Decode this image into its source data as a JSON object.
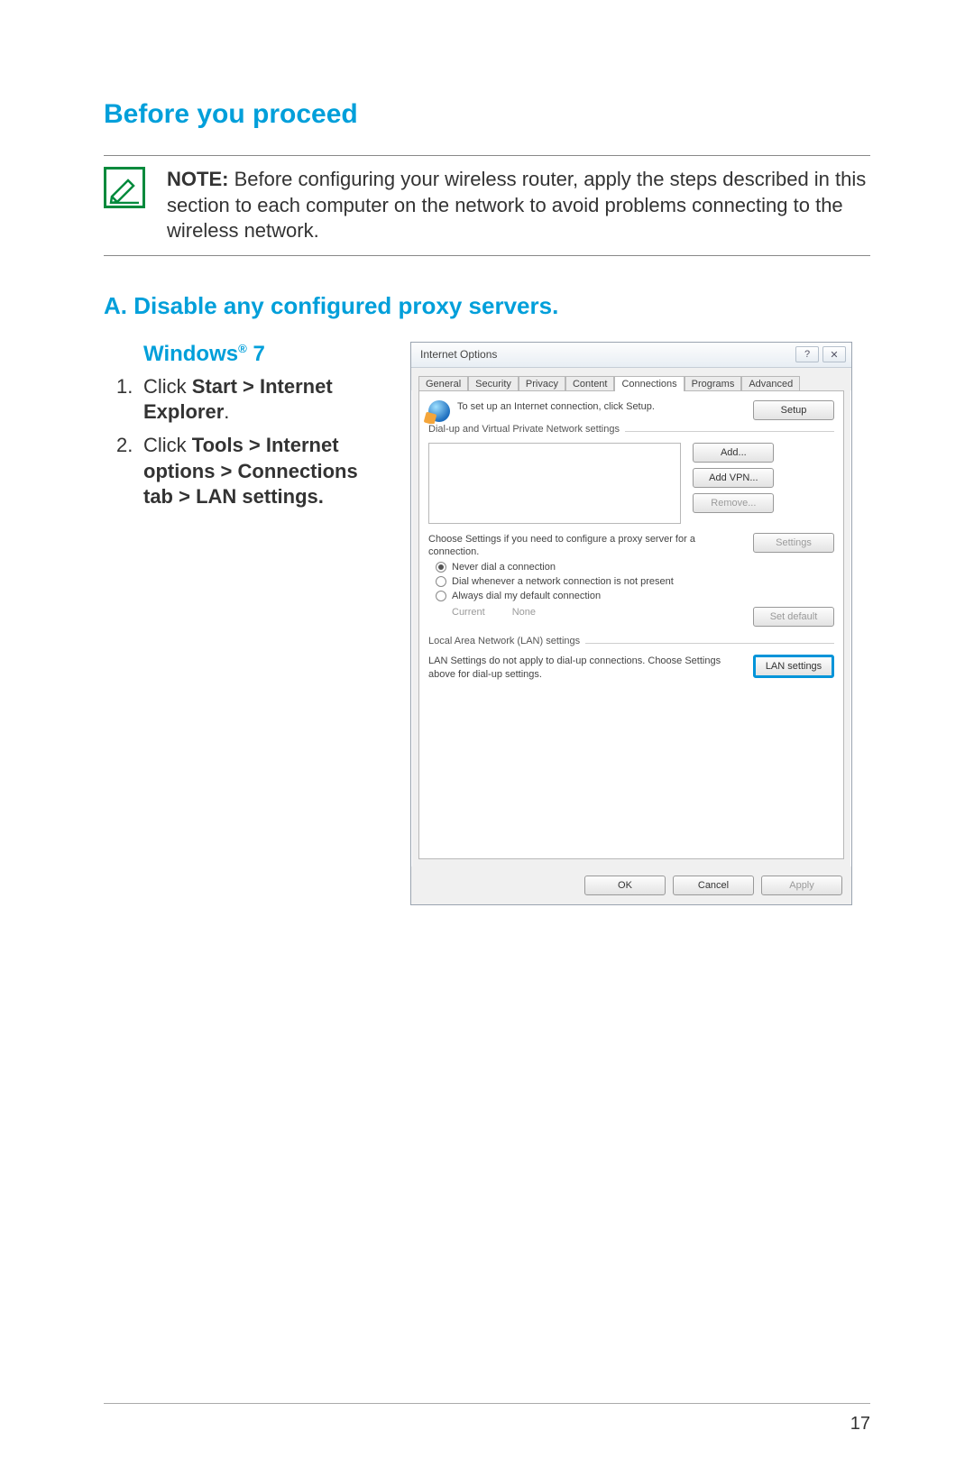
{
  "heading1": "Before you proceed",
  "note": {
    "label": "NOTE:",
    "text": " Before configuring your wireless router, apply the steps described in this section to each computer on the network to avoid problems connecting to the wireless network."
  },
  "heading2": "A.   Disable any configured proxy servers.",
  "heading3_prefix": "Windows",
  "heading3_suffix": " 7",
  "step1_lead": "Click ",
  "step1_bold": "Start > Internet Explorer",
  "step1_tail": ".",
  "step2_lead": "Click ",
  "step2_bold": "Tools > Internet options > Connections tab > LAN settings.",
  "dialog": {
    "title": "Internet Options",
    "tabs": [
      "General",
      "Security",
      "Privacy",
      "Content",
      "Connections",
      "Programs",
      "Advanced"
    ],
    "active_tab_index": 4,
    "setup_text": "To set up an Internet connection, click Setup.",
    "btn_setup": "Setup",
    "dialvpn_legend": "Dial-up and Virtual Private Network settings",
    "btn_add": "Add...",
    "btn_addvpn": "Add VPN...",
    "btn_remove": "Remove...",
    "proxy_text": "Choose Settings if you need to configure a proxy server for a connection.",
    "btn_settings": "Settings",
    "radio1": "Never dial a connection",
    "radio2": "Dial whenever a network connection is not present",
    "radio3": "Always dial my default connection",
    "current_label": "Current",
    "current_value": "None",
    "btn_setdefault": "Set default",
    "lan_legend": "Local Area Network (LAN) settings",
    "lan_text": "LAN Settings do not apply to dial-up connections. Choose Settings above for dial-up settings.",
    "btn_lan": "LAN settings",
    "btn_ok": "OK",
    "btn_cancel": "Cancel",
    "btn_apply": "Apply"
  },
  "page_number": "17"
}
